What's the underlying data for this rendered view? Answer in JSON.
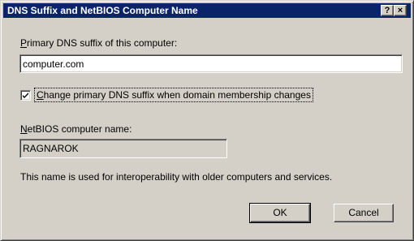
{
  "dialog": {
    "title": "DNS Suffix and NetBIOS Computer Name",
    "help_button": "?",
    "close_button": "×"
  },
  "dns_suffix": {
    "label_mnemonic": "P",
    "label_rest": "rimary DNS suffix of this computer:",
    "value": "computer.com"
  },
  "change_suffix": {
    "checked": true,
    "label_mnemonic": "C",
    "label_rest": "hange primary DNS suffix when domain membership changes"
  },
  "netbios": {
    "label_mnemonic": "N",
    "label_rest": "etBIOS computer name:",
    "value": "RAGNAROK"
  },
  "info_text": "This name is used for interoperability with older computers and services.",
  "buttons": {
    "ok": "OK",
    "cancel": "Cancel"
  }
}
